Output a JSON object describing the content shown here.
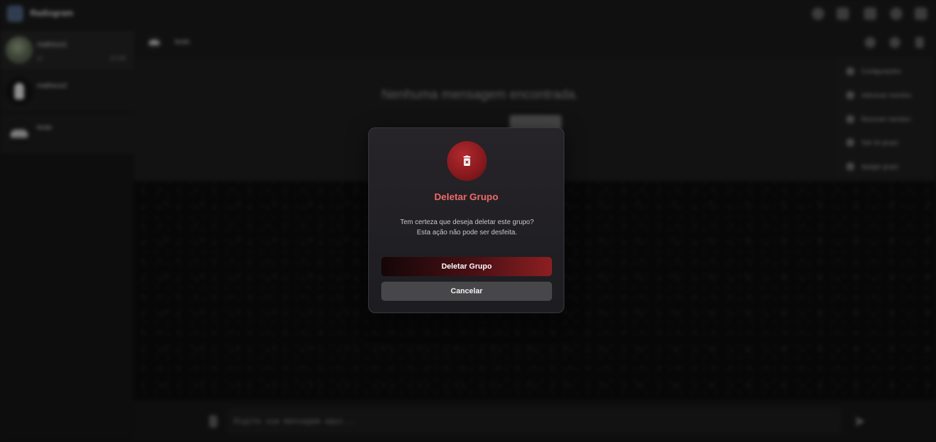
{
  "app": {
    "title": "Radiogram",
    "logo_icon": "app-logo-icon",
    "toolbar_icons": [
      "search-icon",
      "add-group-icon",
      "notifications-icon",
      "settings-icon",
      "close-icon"
    ]
  },
  "sidebar": {
    "chats": [
      {
        "name": "matheus1",
        "preview": "oi",
        "time": "17:44",
        "active": true
      },
      {
        "name": "matheus2",
        "preview": "",
        "time": "",
        "active": false
      },
      {
        "name": "teste",
        "preview": "",
        "time": "",
        "active": false
      }
    ]
  },
  "chat": {
    "header_name": "teste",
    "header_icons": [
      "search-icon",
      "phone-icon",
      "more-options-icon"
    ],
    "empty_message": "Nenhuma mensagem encontrada.",
    "input_placeholder": "Digite sua mensagem aqui..."
  },
  "dropdown": {
    "items": [
      {
        "label": "Configurações",
        "icon": "settings-icon"
      },
      {
        "label": "Adicionar membro",
        "icon": "add-member-icon"
      },
      {
        "label": "Remover membro",
        "icon": "remove-member-icon"
      },
      {
        "label": "Sair do grupo",
        "icon": "exit-icon"
      },
      {
        "label": "Apagar grupo",
        "icon": "delete-icon"
      }
    ]
  },
  "modal": {
    "icon": "trash-icon",
    "title": "Deletar Grupo",
    "message_line1": "Tem certeza que deseja deletar este grupo?",
    "message_line2": "Esta ação não pode ser desfeita.",
    "confirm_label": "Deletar Grupo",
    "cancel_label": "Cancelar",
    "accent_color": "#ef6a6a",
    "danger_color": "#8c1f22"
  }
}
